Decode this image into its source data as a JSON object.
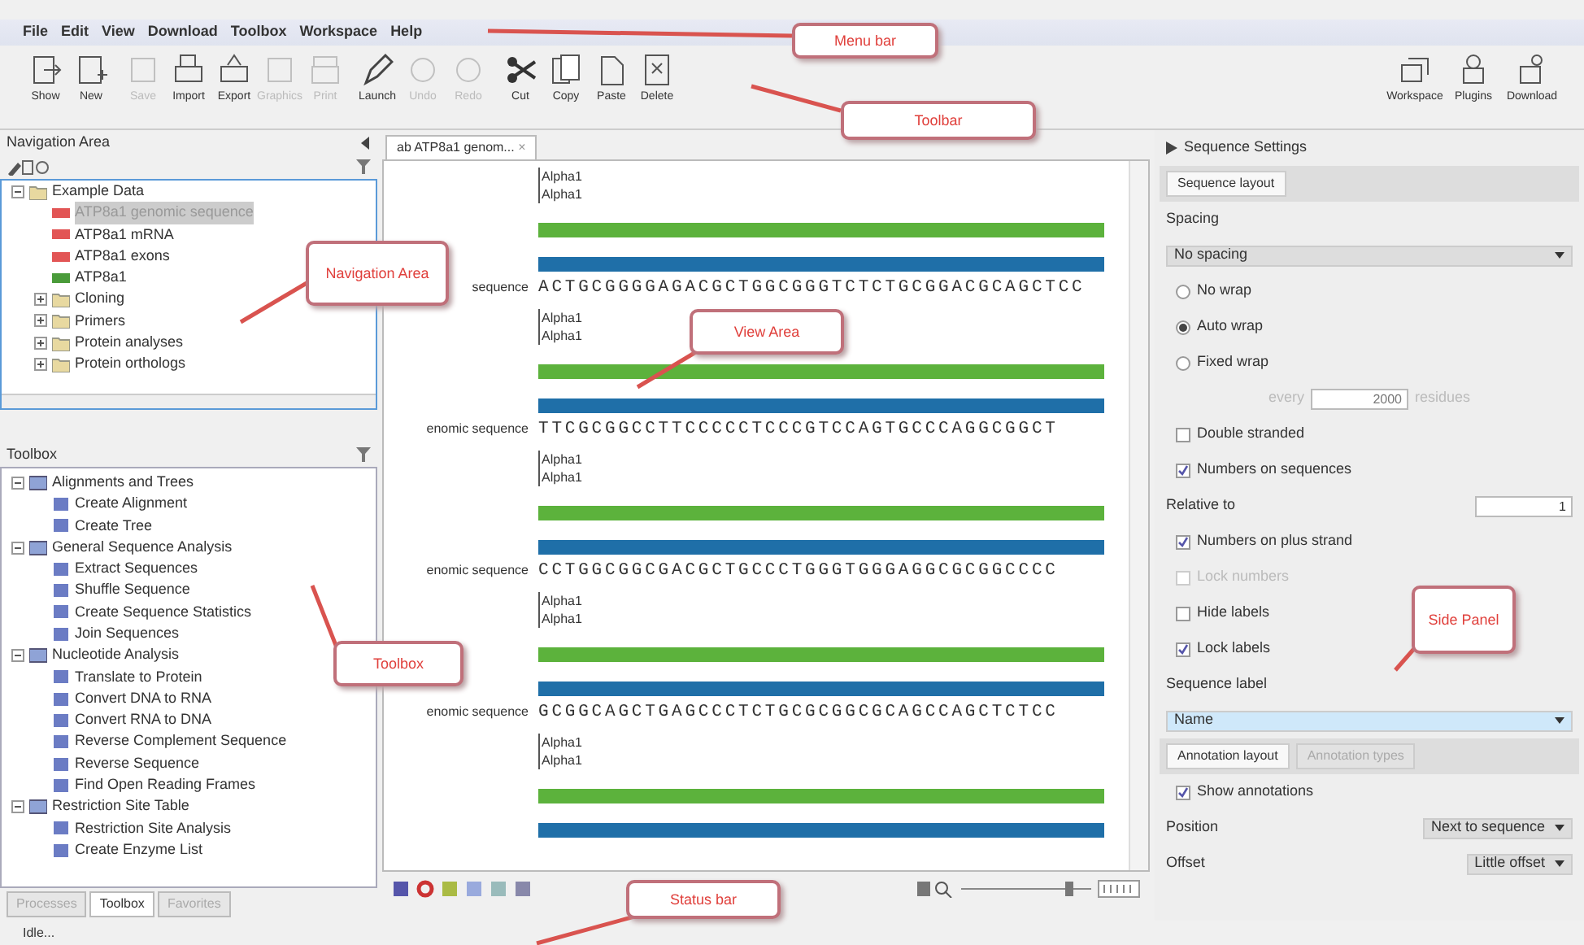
{
  "menu_bar": [
    "File",
    "Edit",
    "View",
    "Download",
    "Toolbox",
    "Workspace",
    "Help"
  ],
  "toolbar": {
    "buttons": [
      {
        "label": "Show",
        "disabled": false
      },
      {
        "label": "New",
        "disabled": false
      },
      {
        "label": "Save",
        "disabled": true
      },
      {
        "label": "Import",
        "disabled": false
      },
      {
        "label": "Export",
        "disabled": false
      },
      {
        "label": "Graphics",
        "disabled": true
      },
      {
        "label": "Print",
        "disabled": true
      },
      {
        "label": "Launch",
        "disabled": false
      },
      {
        "label": "Undo",
        "disabled": true
      },
      {
        "label": "Redo",
        "disabled": true
      },
      {
        "label": "Cut",
        "disabled": false
      },
      {
        "label": "Copy",
        "disabled": false
      },
      {
        "label": "Paste",
        "disabled": false
      },
      {
        "label": "Delete",
        "disabled": false
      }
    ],
    "right_buttons": [
      {
        "label": "Workspace"
      },
      {
        "label": "Plugins"
      },
      {
        "label": "Download"
      }
    ]
  },
  "navigation_area": {
    "title": "Navigation Area",
    "tree": [
      {
        "label": "Example Data",
        "kind": "folder",
        "selected": false,
        "expanded": true,
        "children": [
          {
            "label": "ATP8a1 genomic sequence",
            "kind": "dna",
            "selected": true
          },
          {
            "label": "ATP8a1 mRNA",
            "kind": "dna",
            "selected": false
          },
          {
            "label": "ATP8a1 exons",
            "kind": "dna",
            "selected": false
          },
          {
            "label": "ATP8a1",
            "kind": "protein",
            "selected": false
          },
          {
            "label": "Cloning",
            "kind": "folder",
            "selected": false,
            "expanded": false
          },
          {
            "label": "Primers",
            "kind": "folder",
            "selected": false,
            "expanded": false
          },
          {
            "label": "Protein analyses",
            "kind": "folder",
            "selected": false,
            "expanded": false
          },
          {
            "label": "Protein orthologs",
            "kind": "folder",
            "selected": false,
            "expanded": false
          }
        ]
      }
    ]
  },
  "toolbox": {
    "title": "Toolbox",
    "tree": [
      {
        "label": "Alignments and Trees",
        "kind": "group",
        "expanded": true,
        "children": [
          {
            "label": "Create Alignment",
            "kind": "tool"
          },
          {
            "label": "Create Tree",
            "kind": "tool"
          }
        ]
      },
      {
        "label": "General Sequence Analysis",
        "kind": "group",
        "expanded": true,
        "children": [
          {
            "label": "Extract Sequences",
            "kind": "tool"
          },
          {
            "label": "Shuffle Sequence",
            "kind": "tool"
          },
          {
            "label": "Create Sequence Statistics",
            "kind": "tool"
          },
          {
            "label": "Join Sequences",
            "kind": "tool"
          }
        ]
      },
      {
        "label": "Nucleotide Analysis",
        "kind": "group",
        "expanded": true,
        "children": [
          {
            "label": "Translate to Protein",
            "kind": "tool"
          },
          {
            "label": "Convert DNA to RNA",
            "kind": "tool"
          },
          {
            "label": "Convert RNA to DNA",
            "kind": "tool"
          },
          {
            "label": "Reverse Complement Sequence",
            "kind": "tool"
          },
          {
            "label": "Reverse Sequence",
            "kind": "tool"
          },
          {
            "label": "Find Open Reading Frames",
            "kind": "tool"
          }
        ]
      },
      {
        "label": "Restriction Site Table",
        "kind": "group",
        "expanded": true,
        "children": [
          {
            "label": "Restriction Site Analysis",
            "kind": "tool"
          },
          {
            "label": "Create Enzyme List",
            "kind": "tool"
          }
        ]
      }
    ],
    "tabs": [
      {
        "label": "Processes",
        "selected": false
      },
      {
        "label": "Toolbox",
        "selected": true
      },
      {
        "label": "Favorites",
        "selected": false
      }
    ]
  },
  "status_bar": {
    "text": "Idle..."
  },
  "view_area": {
    "tab": {
      "label": "ab ATP8a1 genom...",
      "close": "×"
    },
    "blocks": [
      {
        "annotations": [
          "Alpha1",
          "Alpha1"
        ],
        "label": "sequence",
        "sequence": "ACTGCGGGGAGACGCTGGCGGGTCTCTGCGGACGCAGCTCC"
      },
      {
        "annotations": [
          "Alpha1",
          "Alpha1"
        ],
        "label": "enomic sequence",
        "sequence": "TTCGCGGCCTTCCCCCTCCCGTCCAGTGCCCAGGCGGCT"
      },
      {
        "annotations": [
          "Alpha1",
          "Alpha1"
        ],
        "label": "enomic sequence",
        "sequence": "CCTGGCGGCGACGCTGCCCTGGGTGGGAGGCGCGGCCCC"
      },
      {
        "annotations": [
          "Alpha1",
          "Alpha1"
        ],
        "label": "enomic sequence",
        "sequence": "GCGGCAGCTGAGCCCTCTGCGCGGCGCAGCCAGCTCTCC"
      },
      {
        "annotations": [
          "Alpha1",
          "Alpha1"
        ]
      }
    ],
    "zoom": {
      "level": 0.85
    }
  },
  "side_panel": {
    "title": "Sequence Settings",
    "section_tabs": [
      {
        "label": "Sequence layout",
        "selected": true
      }
    ],
    "controls": [
      {
        "kind": "heading",
        "label": "Spacing"
      },
      {
        "kind": "dropdown",
        "value": "No spacing",
        "highlighted": false
      },
      {
        "kind": "radio",
        "label": "No wrap",
        "selected": false
      },
      {
        "kind": "radio",
        "label": "Auto wrap",
        "selected": true
      },
      {
        "kind": "radio",
        "label": "Fixed wrap",
        "selected": false
      },
      {
        "kind": "every",
        "label": "every",
        "value": "2000",
        "unit": "residues"
      },
      {
        "kind": "checkbox",
        "label": "Double stranded",
        "checked": false,
        "disabled": false
      },
      {
        "kind": "checkbox",
        "label": "Numbers on sequences",
        "checked": true,
        "disabled": false
      },
      {
        "kind": "field",
        "label": "Relative to",
        "value": "1"
      },
      {
        "kind": "checkbox",
        "label": "Numbers on plus strand",
        "checked": true,
        "disabled": false
      },
      {
        "kind": "checkbox",
        "label": "Lock numbers",
        "checked": false,
        "disabled": true
      },
      {
        "kind": "checkbox",
        "label": "Hide labels",
        "checked": false,
        "disabled": false
      },
      {
        "kind": "checkbox",
        "label": "Lock labels",
        "checked": true,
        "disabled": false
      },
      {
        "kind": "heading",
        "label": "Sequence label"
      },
      {
        "kind": "dropdown",
        "value": "Name",
        "highlighted": true
      },
      {
        "kind": "tabs",
        "tabs": [
          {
            "label": "Annotation layout",
            "selected": true
          },
          {
            "label": "Annotation types",
            "selected": false
          }
        ]
      },
      {
        "kind": "checkbox",
        "label": "Show annotations",
        "checked": true,
        "disabled": false
      },
      {
        "kind": "select",
        "label": "Position",
        "value": "Next to sequence"
      },
      {
        "kind": "select",
        "label": "Offset",
        "value": "Little offset"
      }
    ]
  },
  "callouts": [
    {
      "label": "Menu bar"
    },
    {
      "label": "Toolbar"
    },
    {
      "label": "Navigation Area"
    },
    {
      "label": "View Area"
    },
    {
      "label": "Toolbox"
    },
    {
      "label": "Side Panel"
    },
    {
      "label": "Status bar"
    }
  ]
}
